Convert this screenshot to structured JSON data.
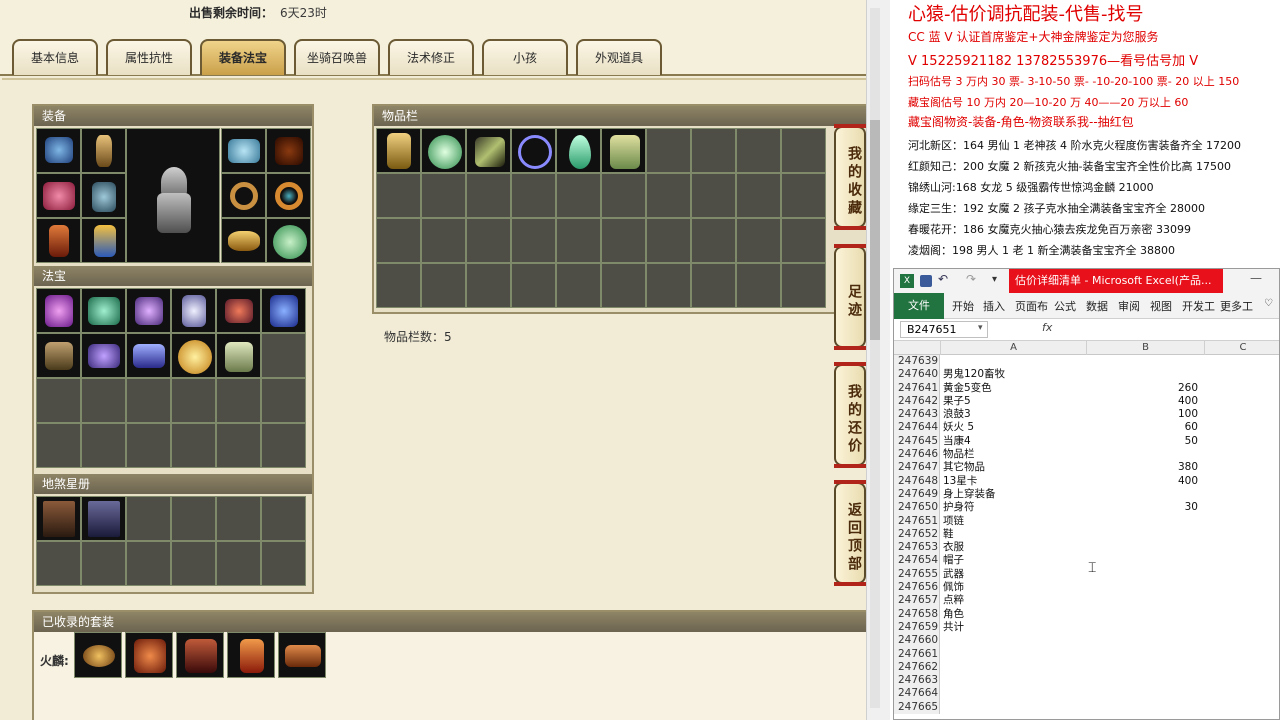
{
  "sale": {
    "label": "出售剩余时间：",
    "value": "6天23时"
  },
  "tabs": [
    "基本信息",
    "属性抗性",
    "装备法宝",
    "坐骑召唤兽",
    "法术修正",
    "小孩",
    "外观道具"
  ],
  "sections": {
    "equipment": "装备",
    "treasure": "法宝",
    "star_book": "地煞星册",
    "bag": "物品栏",
    "bag_count": "物品栏数：5",
    "suits": "已收录的套装",
    "suit_label": "火麟:"
  },
  "side_buttons": [
    "我的收藏",
    "足迹",
    "我的还价",
    "返回顶部"
  ],
  "notes": [
    {
      "text": "心猿-估价调抗配装-代售-找号",
      "color": "red",
      "size": 18
    },
    {
      "text": "CC 蓝 V 认证首席鉴定+大神金牌鉴定为您服务",
      "color": "red",
      "size": 12
    },
    {
      "text": "V 15225921182      13782553976—看号估号加 V",
      "color": "red",
      "size": 13
    },
    {
      "text": "扫码估号 3 万内 30 票- 3-10-50 票- -10-20-100 票- 20 以上 150",
      "color": "red",
      "size": 11
    },
    {
      "text": "藏宝阁估号 10 万内 20—10-20 万 40——20 万以上 60",
      "color": "red",
      "size": 11
    },
    {
      "text": "藏宝阁物资-装备-角色-物资联系我--抽红包",
      "color": "red",
      "size": 12
    },
    {
      "text": "河北新区：164 男仙 1 老神孩 4 阶水克火程度伤害装备齐全 17200",
      "color": "black",
      "size": 11
    },
    {
      "text": "红颜知己：200 女魔 2 新孩克火抽-装备宝宝齐全性价比高 17500",
      "color": "black",
      "size": 11
    },
    {
      "text": "锦绣山河:168 女龙 5 级强霸传世惊鸿金麟 21000",
      "color": "black",
      "size": 11
    },
    {
      "text": "缘定三生：192 女魔 2 孩子克水抽全满装备宝宝齐全 28000",
      "color": "black",
      "size": 11
    },
    {
      "text": "春暖花开：186 女魔克火抽心猿去疾龙免百万亲密 33099",
      "color": "black",
      "size": 11
    },
    {
      "text": "凌烟阁：198 男人 1 老 1 新全满装备宝宝齐全 38800",
      "color": "black",
      "size": 11
    }
  ],
  "excel": {
    "banner": "估价详细清单 - Microsoft Excel(产品...",
    "file_tab": "文件",
    "ribbon": [
      "开始",
      "插入",
      "页面布",
      "公式",
      "数据",
      "审阅",
      "视图",
      "开发工",
      "更多工"
    ],
    "name_box": "B247651",
    "fx": "fx",
    "columns": [
      "A",
      "B",
      "C"
    ],
    "rows": [
      {
        "n": "247639",
        "a": "",
        "b": ""
      },
      {
        "n": "247640",
        "a": "男鬼120畜牧",
        "b": ""
      },
      {
        "n": "247641",
        "a": "黄金5变色",
        "b": "260"
      },
      {
        "n": "247642",
        "a": "果子5",
        "b": "400"
      },
      {
        "n": "247643",
        "a": "浪鼓3",
        "b": "100"
      },
      {
        "n": "247644",
        "a": "妖火 5",
        "b": "60"
      },
      {
        "n": "247645",
        "a": "当康4",
        "b": "50"
      },
      {
        "n": "247646",
        "a": "物品栏",
        "b": ""
      },
      {
        "n": "247647",
        "a": "其它物品",
        "b": "380"
      },
      {
        "n": "247648",
        "a": "13星卡",
        "b": "400"
      },
      {
        "n": "247649",
        "a": "身上穿装备",
        "b": ""
      },
      {
        "n": "247650",
        "a": "护身符",
        "b": "30"
      },
      {
        "n": "247651",
        "a": "项链",
        "b": ""
      },
      {
        "n": "247652",
        "a": "鞋",
        "b": ""
      },
      {
        "n": "247653",
        "a": "衣服",
        "b": ""
      },
      {
        "n": "247654",
        "a": "帽子",
        "b": ""
      },
      {
        "n": "247655",
        "a": "武器",
        "b": ""
      },
      {
        "n": "247656",
        "a": "佩饰",
        "b": ""
      },
      {
        "n": "247657",
        "a": "点粹",
        "b": ""
      },
      {
        "n": "247658",
        "a": "角色",
        "b": ""
      },
      {
        "n": "247659",
        "a": "共计",
        "b": ""
      },
      {
        "n": "247660",
        "a": "",
        "b": ""
      },
      {
        "n": "247661",
        "a": "",
        "b": ""
      },
      {
        "n": "247662",
        "a": "",
        "b": ""
      },
      {
        "n": "247663",
        "a": "",
        "b": ""
      },
      {
        "n": "247664",
        "a": "",
        "b": ""
      },
      {
        "n": "247665",
        "a": "",
        "b": ""
      }
    ]
  },
  "colors": {
    "tab_active": "#caa04a",
    "section_head": "#6c6450",
    "note_red": "#e00000",
    "excel_green": "#21733f",
    "banner_red": "#e8101a"
  }
}
